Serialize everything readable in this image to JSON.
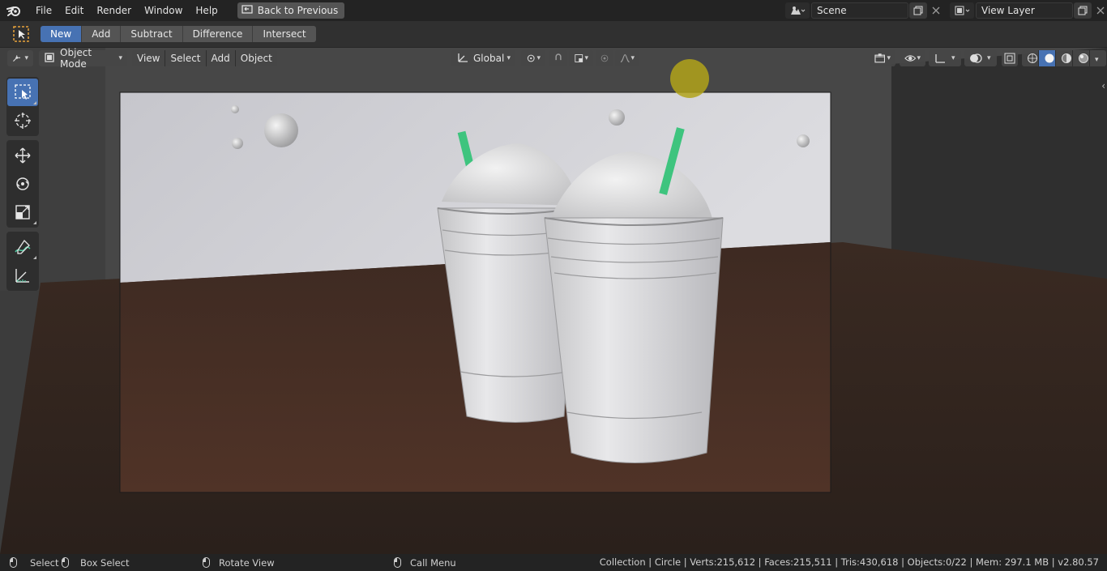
{
  "menu": [
    "File",
    "Edit",
    "Render",
    "Window",
    "Help"
  ],
  "back_button": "Back to Previous",
  "scene": {
    "label": "Scene"
  },
  "view_layer": {
    "label": "View Layer"
  },
  "tool_settings": {
    "modes": [
      "New",
      "Add",
      "Subtract",
      "Difference",
      "Intersect"
    ],
    "active": "New"
  },
  "viewport_header": {
    "mode": "Object Mode",
    "menus": [
      "View",
      "Select",
      "Add",
      "Object"
    ],
    "orientation": "Global"
  },
  "status": {
    "select": "Select",
    "box_select": "Box Select",
    "rotate_view": "Rotate View",
    "call_menu": "Call Menu",
    "stats": "Collection | Circle | Verts:215,612 | Faces:215,511 | Tris:430,618 | Objects:0/22 | Mem: 297.1 MB | v2.80.57"
  },
  "colors": {
    "accent": "#4772b3",
    "straw": "#3ec47e",
    "table": "#4a2f23"
  }
}
